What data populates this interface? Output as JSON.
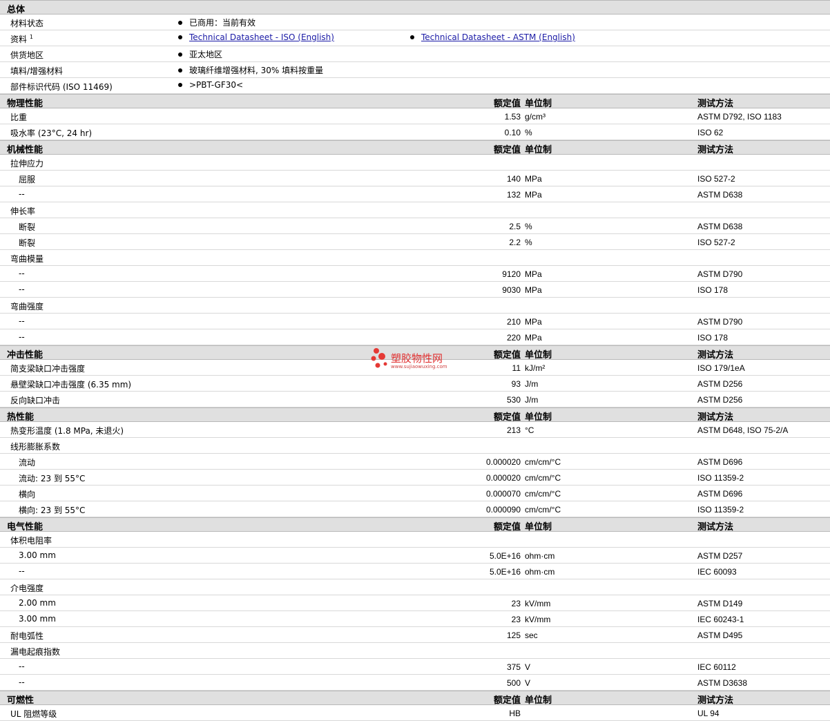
{
  "general": {
    "title": "总体",
    "material_status": {
      "label": "材料状态",
      "value": "已商用：当前有效"
    },
    "resources": {
      "label": "资料",
      "sup": "1",
      "link1": "Technical Datasheet - ISO (English)",
      "link2": "Technical Datasheet - ASTM (English)"
    },
    "availability": {
      "label": "供货地区",
      "value": "亚太地区"
    },
    "filler": {
      "label": "填料/增强材料",
      "value": "玻璃纤维增强材料, 30% 填料按重量"
    },
    "part_marking": {
      "label": "部件标识代码 (ISO 11469)",
      "value": ">PBT-GF30<"
    }
  },
  "columns": {
    "value": "额定值",
    "unit": "单位制",
    "method": "测试方法"
  },
  "sections": [
    {
      "title": "物理性能",
      "rows": [
        {
          "label": "比重",
          "value": "1.53",
          "unit": "g/cm³",
          "method": "ASTM D792, ISO 1183"
        },
        {
          "label": "吸水率 (23°C, 24 hr)",
          "value": "0.10",
          "unit": "%",
          "method": "ISO 62"
        }
      ]
    },
    {
      "title": "机械性能",
      "rows": [
        {
          "label": "拉伸应力",
          "group": true
        },
        {
          "label": "屈服",
          "sub": true,
          "value": "140",
          "unit": "MPa",
          "method": "ISO 527-2"
        },
        {
          "label": "--",
          "sub": true,
          "value": "132",
          "unit": "MPa",
          "method": "ASTM D638"
        },
        {
          "label": "伸长率",
          "group": true
        },
        {
          "label": "断裂",
          "sub": true,
          "value": "2.5",
          "unit": "%",
          "method": "ASTM D638"
        },
        {
          "label": "断裂",
          "sub": true,
          "value": "2.2",
          "unit": "%",
          "method": "ISO 527-2"
        },
        {
          "label": "弯曲模量",
          "group": true
        },
        {
          "label": "--",
          "sub": true,
          "value": "9120",
          "unit": "MPa",
          "method": "ASTM D790"
        },
        {
          "label": "--",
          "sub": true,
          "value": "9030",
          "unit": "MPa",
          "method": "ISO 178"
        },
        {
          "label": "弯曲强度",
          "group": true
        },
        {
          "label": "--",
          "sub": true,
          "value": "210",
          "unit": "MPa",
          "method": "ASTM D790"
        },
        {
          "label": "--",
          "sub": true,
          "value": "220",
          "unit": "MPa",
          "method": "ISO 178"
        }
      ]
    },
    {
      "title": "冲击性能",
      "rows": [
        {
          "label": "简支梁缺口冲击强度",
          "value": "11",
          "unit": "kJ/m²",
          "method": "ISO 179/1eA"
        },
        {
          "label": "悬壁梁缺口冲击强度 (6.35 mm)",
          "value": "93",
          "unit": "J/m",
          "method": "ASTM D256"
        },
        {
          "label": "反向缺口冲击",
          "value": "530",
          "unit": "J/m",
          "method": "ASTM D256"
        }
      ]
    },
    {
      "title": "热性能",
      "rows": [
        {
          "label": "热变形温度 (1.8 MPa, 未退火)",
          "value": "213",
          "unit": "°C",
          "method": "ASTM D648, ISO 75-2/A"
        },
        {
          "label": "线形膨胀系数",
          "group": true
        },
        {
          "label": "流动",
          "sub": true,
          "value": "0.000020",
          "unit": "cm/cm/°C",
          "method": "ASTM D696"
        },
        {
          "label": "流动: 23 到  55°C",
          "sub": true,
          "value": "0.000020",
          "unit": "cm/cm/°C",
          "method": "ISO 11359-2"
        },
        {
          "label": "横向",
          "sub": true,
          "value": "0.000070",
          "unit": "cm/cm/°C",
          "method": "ASTM D696"
        },
        {
          "label": "横向: 23 到  55°C",
          "sub": true,
          "value": "0.000090",
          "unit": "cm/cm/°C",
          "method": "ISO 11359-2"
        }
      ]
    },
    {
      "title": "电气性能",
      "rows": [
        {
          "label": "体积电阻率",
          "group": true
        },
        {
          "label": "3.00 mm",
          "sub": true,
          "value": "5.0E+16",
          "unit": "ohm·cm",
          "method": "ASTM D257"
        },
        {
          "label": "--",
          "sub": true,
          "value": "5.0E+16",
          "unit": "ohm·cm",
          "method": "IEC 60093"
        },
        {
          "label": "介电强度",
          "group": true
        },
        {
          "label": "2.00 mm",
          "sub": true,
          "value": "23",
          "unit": "kV/mm",
          "method": "ASTM D149"
        },
        {
          "label": "3.00 mm",
          "sub": true,
          "value": "23",
          "unit": "kV/mm",
          "method": "IEC 60243-1"
        },
        {
          "label": "耐电弧性",
          "value": "125",
          "unit": "sec",
          "method": "ASTM D495"
        },
        {
          "label": "漏电起痕指数",
          "group": true
        },
        {
          "label": "--",
          "sub": true,
          "value": "375",
          "unit": "V",
          "method": "IEC 60112"
        },
        {
          "label": "--",
          "sub": true,
          "value": "500",
          "unit": "V",
          "method": "ASTM D3638"
        }
      ]
    },
    {
      "title": "可燃性",
      "rows": [
        {
          "label": "UL 阻燃等级",
          "value": "HB",
          "unit": "",
          "method": "UL 94"
        }
      ]
    }
  ],
  "watermark": {
    "text": "塑胶物性网",
    "url": "www.sujiaowuxing.com",
    "color": "#e03030"
  }
}
